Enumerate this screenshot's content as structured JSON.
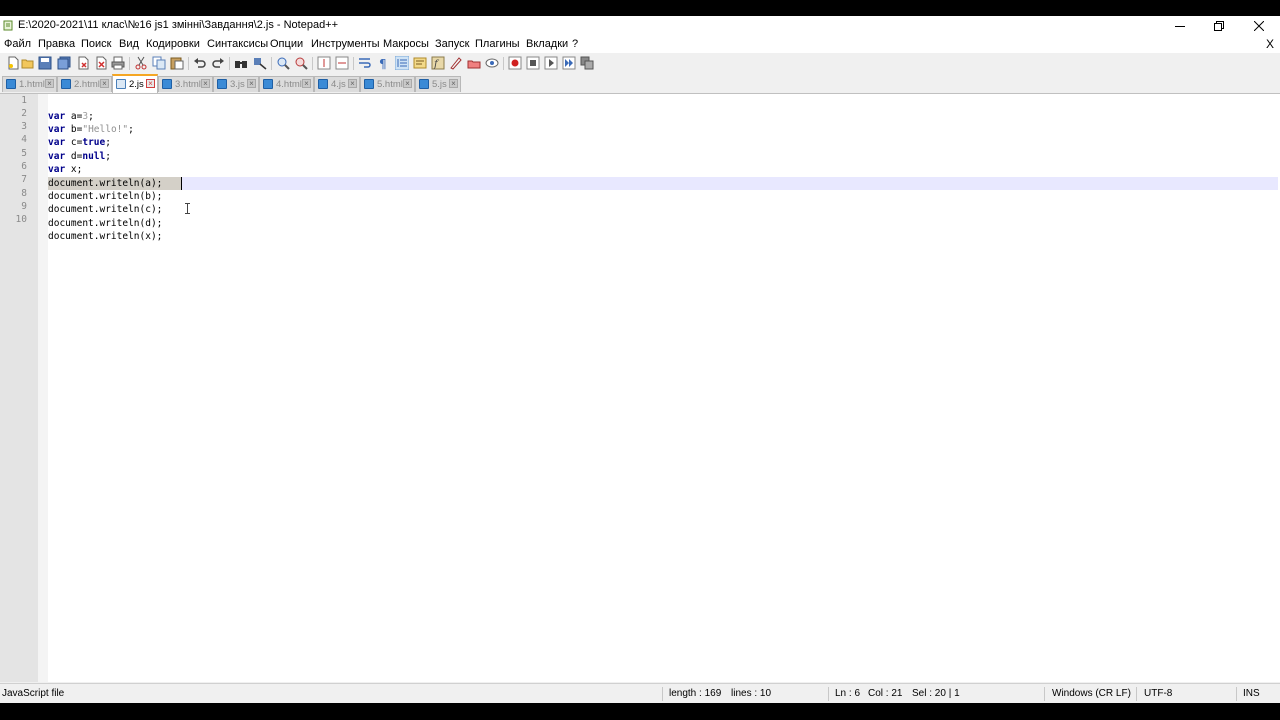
{
  "window": {
    "title": "E:\\2020-2021\\11 клас\\№16 js1 змінні\\Завдання\\2.js - Notepad++"
  },
  "menu": [
    "Файл",
    "Правка",
    "Поиск",
    "Вид",
    "Кодировки",
    "Синтаксисы",
    "Опции",
    "Инструменты",
    "Макросы",
    "Запуск",
    "Плагины",
    "Вкладки",
    "?"
  ],
  "menu_close": "X",
  "toolbar": {
    "buttons": [
      "new-file-icon",
      "open-file-icon",
      "save-icon",
      "save-all-icon",
      "close-icon",
      "close-all-icon",
      "print-icon",
      "cut-icon",
      "copy-icon",
      "paste-icon",
      "undo-icon",
      "redo-icon",
      "find-icon",
      "replace-icon",
      "zoom-in-icon",
      "zoom-out-icon",
      "sync-vertical-icon",
      "sync-horizontal-icon",
      "word-wrap-icon",
      "show-all-characters-icon",
      "indent-guide-icon",
      "doc-map-icon",
      "function-list-icon",
      "folder-as-workspace-icon",
      "monitoring-icon",
      "preview-icon",
      "record-macro-icon",
      "stop-macro-icon",
      "play-macro-icon",
      "run-macro-multiple-icon",
      "save-macro-icon"
    ]
  },
  "tabs": [
    {
      "label": "1.html",
      "active": false
    },
    {
      "label": "2.html",
      "active": false
    },
    {
      "label": "2.js",
      "active": true
    },
    {
      "label": "3.html",
      "active": false
    },
    {
      "label": "3.js",
      "active": false
    },
    {
      "label": "4.html",
      "active": false
    },
    {
      "label": "4.js",
      "active": false
    },
    {
      "label": "5.html",
      "active": false
    },
    {
      "label": "5.js",
      "active": false
    }
  ],
  "editor": {
    "lines": [
      {
        "num": "1",
        "kw": "var",
        "rest_a": " a=",
        "lit": "3",
        "rest_b": ";"
      },
      {
        "num": "2",
        "kw": "var",
        "rest_a": " b=",
        "lit": "\"Hello!\"",
        "rest_b": ";"
      },
      {
        "num": "3",
        "kw": "var",
        "rest_a": " c=",
        "lit": "true",
        "rest_b": ";"
      },
      {
        "num": "4",
        "kw": "var",
        "rest_a": " d=",
        "lit": "null",
        "rest_b": ";"
      },
      {
        "num": "5",
        "kw": "var",
        "rest_a": " x;",
        "lit": "",
        "rest_b": ""
      },
      {
        "num": "6",
        "text": "document.writeln(a);"
      },
      {
        "num": "7",
        "text": "document.writeln(b);"
      },
      {
        "num": "8",
        "text": "document.writeln(c);"
      },
      {
        "num": "9",
        "text": "document.writeln(d);"
      },
      {
        "num": "10",
        "text": "document.writeln(x);"
      }
    ],
    "current_line": 6
  },
  "status": {
    "file_type": "JavaScript file",
    "length": "length : 169",
    "lines": "lines : 10",
    "ln": "Ln : 6",
    "col": "Col : 21",
    "sel": "Sel : 20 | 1",
    "eol": "Windows (CR LF)",
    "encoding": "UTF-8",
    "mode": "INS"
  }
}
